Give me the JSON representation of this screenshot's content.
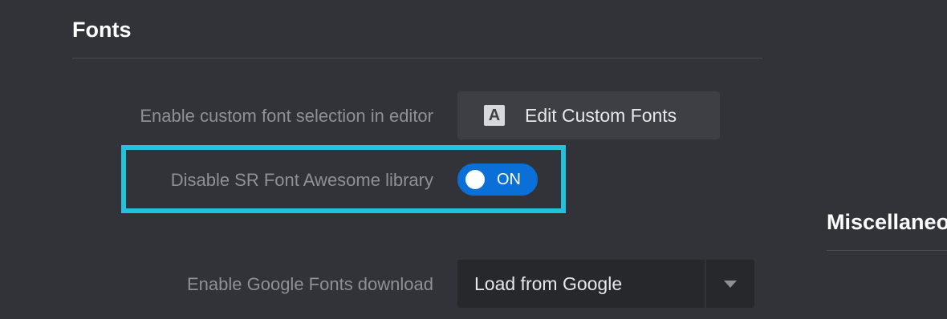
{
  "fonts_section": {
    "title": "Fonts"
  },
  "custom_font_row": {
    "label": "Enable custom font selection in editor",
    "button_icon_letter": "A",
    "button_icon": "font-letter-a-icon",
    "button_label": "Edit Custom Fonts"
  },
  "font_awesome_row": {
    "label": "Disable SR Font Awesome library",
    "toggle_state": "ON",
    "highlight_color": "#22c1dc"
  },
  "google_fonts_row": {
    "label": "Enable Google Fonts download",
    "select_value": "Load from Google",
    "select_icon": "chevron-down-icon"
  },
  "misc_section": {
    "title": "Miscellaneous"
  },
  "colors": {
    "background": "#323338",
    "toggle_on": "#0a6fd6",
    "button_bg": "#3e3f45",
    "select_bg": "#27282c"
  }
}
